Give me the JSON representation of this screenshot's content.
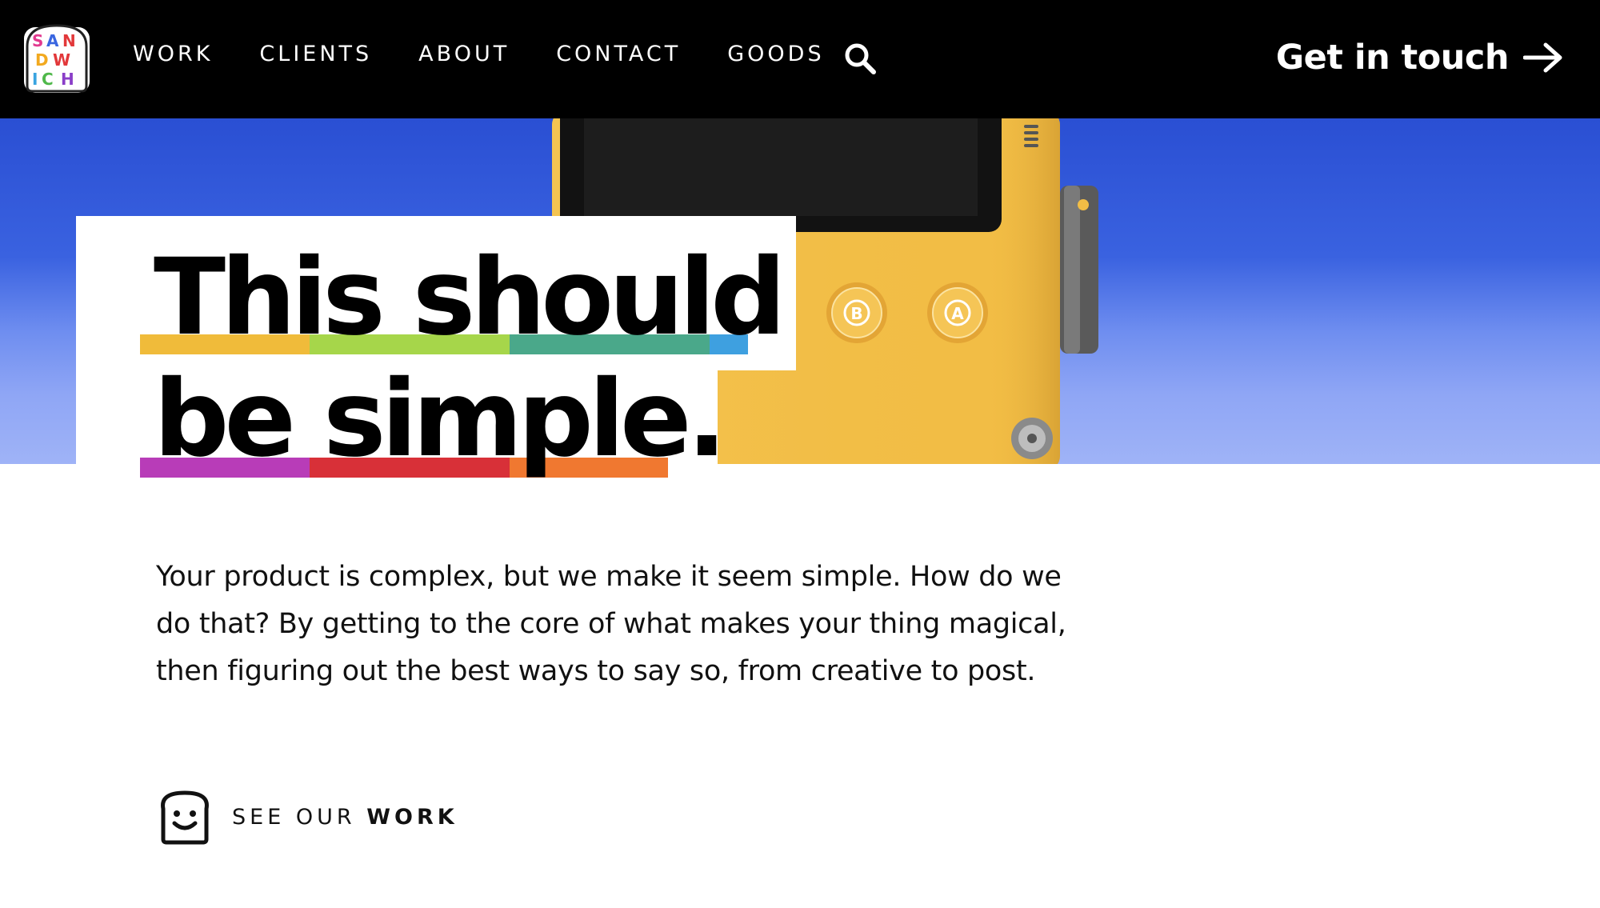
{
  "header": {
    "logo_name": "sandwich-logo",
    "nav": [
      {
        "label": "WORK"
      },
      {
        "label": "CLIENTS"
      },
      {
        "label": "ABOUT"
      },
      {
        "label": "CONTACT"
      },
      {
        "label": "GOODS"
      }
    ],
    "search_icon": "search-icon",
    "cta_label": "Get in touch",
    "cta_icon": "arrow-right-icon"
  },
  "hero": {
    "headline_line1": "This should",
    "headline_line2": "be simple.",
    "device_button_b": "B",
    "device_button_a": "A"
  },
  "intro": {
    "text": "Your product is complex, but we make it seem simple. How do we do that? By getting to the core of what makes your thing magical, then figuring out the best ways to say so, from creative to post."
  },
  "cta_work": {
    "prefix": "SEE OUR ",
    "strong": "WORK",
    "icon": "toast-face-icon"
  },
  "colors": {
    "topbar": "#000000",
    "sky": "#2a4fd3",
    "device": "#f2bd45",
    "stripe_yellow": "#f0bb3a",
    "stripe_green": "#a6d64a",
    "stripe_teal": "#4aa88a",
    "stripe_blue": "#3ea0e0",
    "stripe_magenta": "#b83cb8",
    "stripe_red": "#d83038",
    "stripe_orange": "#f07830"
  }
}
